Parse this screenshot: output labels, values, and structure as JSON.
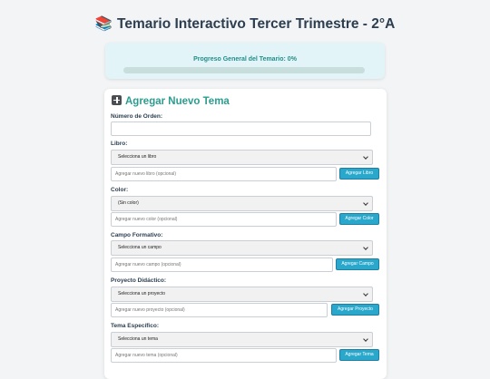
{
  "header": {
    "emoji": "📚",
    "title": "Temario Interactivo Tercer Trimestre - 2°A"
  },
  "progress": {
    "label": "Progreso General del Temario: 0%",
    "value_percent": 0
  },
  "form": {
    "section_title": "Agregar Nuevo Tema",
    "order": {
      "label": "Número de Orden:",
      "value": ""
    },
    "libro": {
      "label": "Libro:",
      "selected": "Selecciona un libro",
      "add_placeholder": "Agregar nuevo libro (opcional)",
      "add_button": "Agregar Libro"
    },
    "color": {
      "label": "Color:",
      "selected": "(Sin color)",
      "add_placeholder": "Agregar nuevo color (opcional)",
      "add_button": "Agregar Color"
    },
    "campo": {
      "label": "Campo Formativo:",
      "selected": "Selecciona un campo",
      "add_placeholder": "Agregar nuevo campo (opcional)",
      "add_button": "Agregar Campo"
    },
    "proyecto": {
      "label": "Proyecto Didáctico:",
      "selected": "Selecciona un proyecto",
      "add_placeholder": "Agregar nuevo proyecto (opcional)",
      "add_button": "Agregar Proyecto"
    },
    "tema": {
      "label": "Tema Específico:",
      "selected": "Selecciona un tema",
      "add_placeholder": "Agregar nuevo tema (opcional)",
      "add_button": "Agregar Tema"
    }
  },
  "colors": {
    "accent": "#2a9d8f",
    "button": "#2aa8cc",
    "progress_bg": "#e3f4f9"
  }
}
